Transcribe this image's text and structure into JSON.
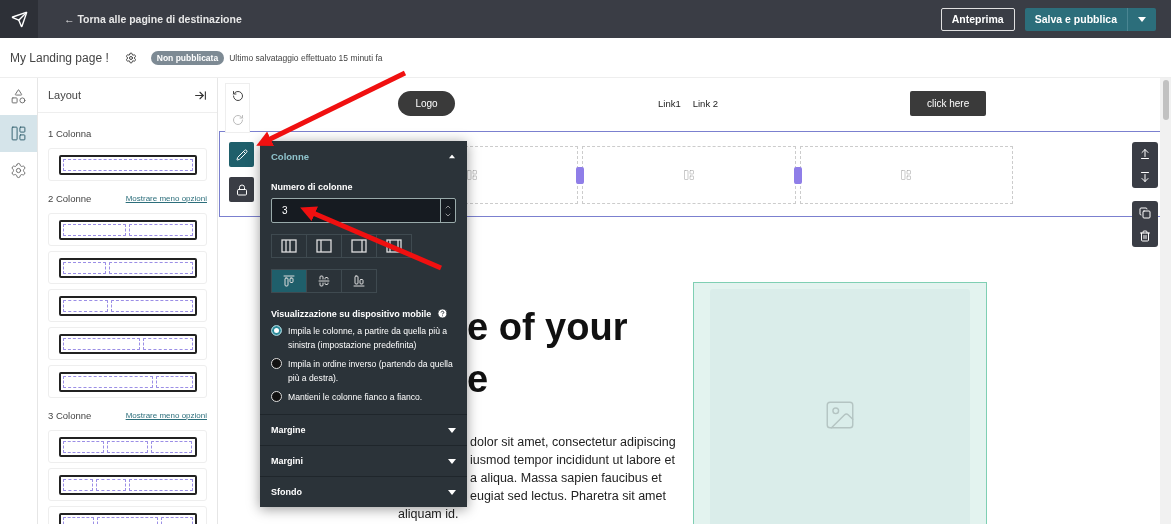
{
  "topbar": {
    "back_link": "← Torna alle pagine di destinazione",
    "buttons": [
      {
        "label": "Anteprima",
        "kind": "outline"
      },
      {
        "label": "Salva e pubblica",
        "kind": "primary"
      }
    ]
  },
  "page_header": {
    "title": "My Landing page !",
    "status": "Non pubblicata",
    "last_saved": "Ultimo salvataggio effettuato 15 minuti fa"
  },
  "rail": [
    {
      "kind": "elements",
      "selected": false
    },
    {
      "kind": "layout",
      "selected": true
    },
    {
      "kind": "settings",
      "selected": false
    }
  ],
  "layout_panel": {
    "title": "Layout",
    "groups": [
      {
        "label": "1 Colonna",
        "options": [
          {
            "kind": "full"
          }
        ]
      },
      {
        "label": "2 Colonne",
        "link": "Mostrare meno opzioni",
        "options": [
          {
            "kind": "halves"
          },
          {
            "kind": "narrow-wide"
          },
          {
            "kind": "third-left"
          },
          {
            "kind": "wide-narrow"
          },
          {
            "kind": "wider-narrow"
          }
        ]
      },
      {
        "label": "3 Colonne",
        "link": "Mostrare meno opzioni",
        "options": [
          {
            "kind": "thirds"
          },
          {
            "kind": "quarter-quarter-half"
          },
          {
            "kind": "quarter-half-quarter"
          }
        ]
      }
    ]
  },
  "history": [
    {
      "kind": "undo",
      "disabled": false
    },
    {
      "kind": "redo",
      "disabled": true
    }
  ],
  "nav": {
    "logo": "Logo",
    "links": [
      "Link1",
      "Link 2"
    ],
    "cta": "click here"
  },
  "row_tools": [
    {
      "kind": "edit",
      "selected": true
    },
    {
      "kind": "lock",
      "selected": false
    }
  ],
  "hero": {
    "heading_lines": [
      {
        "text": "e of your",
        "covered": true
      },
      {
        "text": "e",
        "covered": true
      }
    ],
    "paragraph_lines": [
      {
        "text": "dolor sit amet, consectetur adipiscing",
        "covered": true
      },
      {
        "text": "iusmod tempor incididunt ut labore et",
        "covered": true
      },
      {
        "text": "a aliqua. Massa sapien faucibus et",
        "covered": true
      },
      {
        "text": "eugiat sed lectus. Pharetra sit amet",
        "covered": true
      },
      {
        "text": "aliquam id.",
        "covered": false
      }
    ]
  },
  "popover": {
    "title": "Colonne",
    "expanded": true,
    "count_label": "Numero di colonne",
    "count_value": "3",
    "width_options": [
      {
        "kind": "equal"
      },
      {
        "kind": "left"
      },
      {
        "kind": "right"
      },
      {
        "kind": "edges"
      }
    ],
    "align_options": [
      {
        "kind": "top",
        "selected": true
      },
      {
        "kind": "middle",
        "selected": false
      },
      {
        "kind": "bottom",
        "selected": false
      }
    ],
    "mobile_label": "Visualizzazione su dispositivo mobile",
    "mobile_options": [
      {
        "label": "Impila le colonne, a partire da quella più a sinistra (impostazione predefinita)",
        "selected": true
      },
      {
        "label": "Impila in ordine inverso (partendo da quella più a destra).",
        "selected": false
      },
      {
        "label": "Mantieni le colonne fianco a fianco.",
        "selected": false
      }
    ],
    "sections": [
      {
        "label": "Margine",
        "expanded": false
      },
      {
        "label": "Margini",
        "expanded": false
      },
      {
        "label": "Sfondo",
        "expanded": false
      }
    ]
  }
}
